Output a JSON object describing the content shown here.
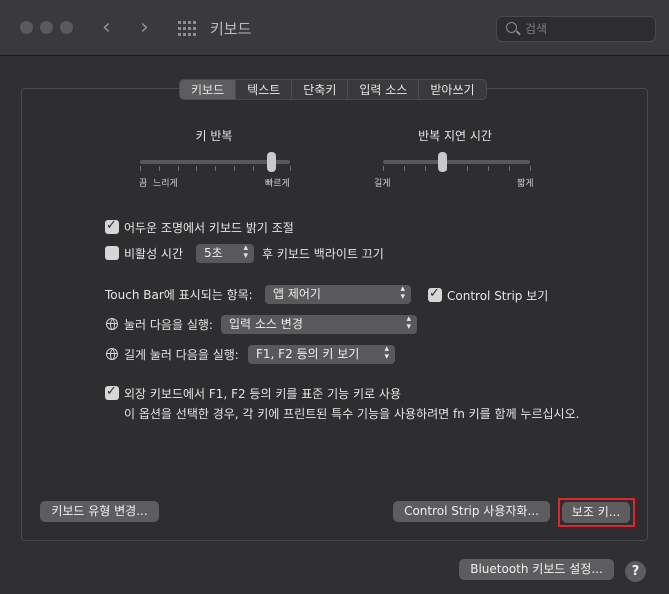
{
  "window": {
    "title": "키보드"
  },
  "search": {
    "placeholder": "검색"
  },
  "tabs": [
    {
      "label": "키보드",
      "active": true
    },
    {
      "label": "텍스트",
      "active": false
    },
    {
      "label": "단축키",
      "active": false
    },
    {
      "label": "입력 소스",
      "active": false
    },
    {
      "label": "받아쓰기",
      "active": false
    }
  ],
  "key_repeat": {
    "label": "키 반복",
    "min_labels": [
      "끔",
      "느리게"
    ],
    "max_label": "빠르게",
    "level": 0.875
  },
  "repeat_delay": {
    "label": "반복 지연 시간",
    "min_label": "길게",
    "max_label": "짧게",
    "level": 0.4
  },
  "options": {
    "backlight_adjust": {
      "label": "어두운 조명에서 키보드 밝기 조절",
      "checked": true
    },
    "inactivity": {
      "label_before": "비활성 시간",
      "value": "5초",
      "label_after": "후 키보드 백라이트 끄기",
      "checked": false
    },
    "touchbar": {
      "label": "Touch Bar에 표시되는 항목:",
      "value": "앱 제어기"
    },
    "control_strip": {
      "label": "Control Strip 보기",
      "checked": true
    },
    "press_fn": {
      "label": "눌러 다음을 실행:",
      "value": "입력 소스 변경"
    },
    "hold_fn": {
      "label": "길게 눌러 다음을 실행:",
      "value": "F1, F2 등의 키 보기"
    },
    "fkeys": {
      "label": "외장 키보드에서 F1, F2 등의 키를 표준 기능 키로 사용",
      "description": "이 옵션을 선택한 경우, 각 키에 프린트된 특수 기능을 사용하려면 fn 키를 함께 누르십시오.",
      "checked": true
    }
  },
  "buttons": {
    "change_type": "키보드 유형 변경...",
    "customize_strip": "Control Strip 사용자화...",
    "modifier_keys": "보조 키...",
    "bluetooth": "Bluetooth 키보드 설정...",
    "help": "?"
  },
  "colors": {
    "highlight": "#e0262b"
  }
}
